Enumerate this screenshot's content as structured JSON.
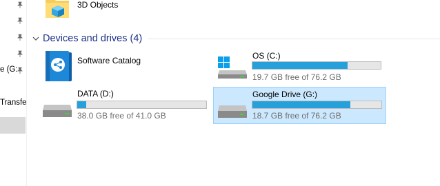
{
  "nav": {
    "items": [
      {
        "label": "",
        "pinned": true
      },
      {
        "label": "",
        "pinned": true
      },
      {
        "label": "",
        "pinned": true
      },
      {
        "label": "",
        "pinned": true
      },
      {
        "label": "e (G:",
        "pinned": true
      }
    ],
    "transfer_label": "Transfe"
  },
  "folder": {
    "label": "3D Objects"
  },
  "group": {
    "title": "Devices and drives (4)"
  },
  "drives": [
    {
      "name": "Software Catalog",
      "icon": "software-catalog-icon"
    },
    {
      "name": "OS (C:)",
      "free": "19.7 GB free of 76.2 GB",
      "used_fraction": 0.74,
      "icon": "windows-drive-icon"
    },
    {
      "name": "DATA (D:)",
      "free": "38.0 GB free of 41.0 GB",
      "used_fraction": 0.07,
      "icon": "hard-drive-icon"
    },
    {
      "name": "Google Drive (G:)",
      "free": "18.7 GB free of 76.2 GB",
      "used_fraction": 0.76,
      "icon": "hard-drive-icon",
      "selected": true
    }
  ],
  "colors": {
    "accent": "#26a0da",
    "header": "#1e3287",
    "selection": "#cce8ff"
  }
}
